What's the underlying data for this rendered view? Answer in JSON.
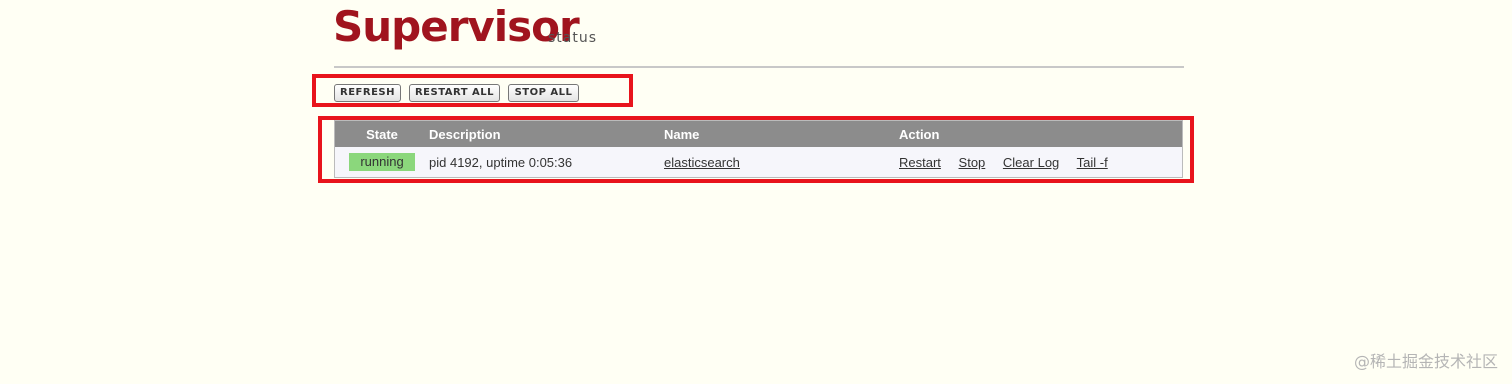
{
  "header": {
    "title": "Supervisor",
    "subtitle": "status"
  },
  "toolbar": {
    "refresh_label": "REFRESH",
    "restart_all_label": "RESTART ALL",
    "stop_all_label": "STOP ALL"
  },
  "table": {
    "headers": {
      "state": "State",
      "description": "Description",
      "name": "Name",
      "action": "Action"
    },
    "rows": [
      {
        "state": "running",
        "description": "pid 4192, uptime 0:05:36",
        "name": "elasticsearch",
        "actions": [
          "Restart",
          "Stop",
          "Clear Log",
          "Tail -f"
        ]
      }
    ]
  },
  "watermark": "@稀土掘金技术社区",
  "colors": {
    "brand": "#a0141e",
    "highlight": "#e8141c",
    "running": "#8bd77c",
    "table_header": "#8c8c8c"
  }
}
